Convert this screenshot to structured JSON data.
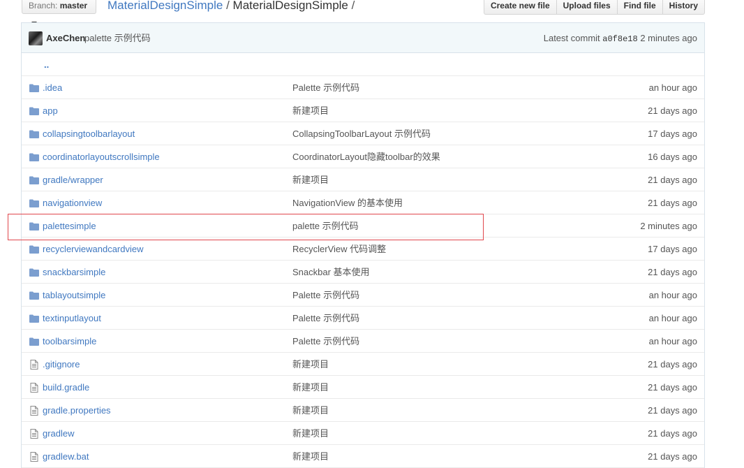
{
  "branch": {
    "prefix": "Branch:",
    "name": "master"
  },
  "breadcrumb": {
    "repo": "MaterialDesignSimple",
    "sep1": "/",
    "folder": "MaterialDesignSimple",
    "sep2": "/"
  },
  "actions": {
    "create_new_file": "Create new file",
    "upload_files": "Upload files",
    "find_file": "Find file",
    "history": "History"
  },
  "commit": {
    "author": "AxeChen",
    "message": "palette 示例代码",
    "latest_label": "Latest commit",
    "sha": "a0f8e18",
    "age": "2 minutes ago"
  },
  "parent_dir": "..",
  "colors": {
    "link": "#4078c0",
    "highlight": "#e0474c",
    "commit_bg": "#f2f8fa"
  },
  "files": [
    {
      "type": "folder",
      "icon": "folder-icon",
      "name": ".idea",
      "message": "Palette 示例代码",
      "age": "an hour ago"
    },
    {
      "type": "folder",
      "icon": "folder-icon",
      "name": "app",
      "message": "新建项目",
      "age": "21 days ago"
    },
    {
      "type": "folder",
      "icon": "folder-icon",
      "name": "collapsingtoolbarlayout",
      "message": "CollapsingToolbarLayout 示例代码",
      "age": "17 days ago"
    },
    {
      "type": "folder",
      "icon": "folder-icon",
      "name": "coordinatorlayoutscrollsimple",
      "message": "CoordinatorLayout隐藏toolbar的效果",
      "age": "16 days ago"
    },
    {
      "type": "folder",
      "icon": "folder-icon",
      "name": "gradle/wrapper",
      "message": "新建项目",
      "age": "21 days ago"
    },
    {
      "type": "folder",
      "icon": "folder-icon",
      "name": "navigationview",
      "message": "NavigationView 的基本使用",
      "age": "21 days ago"
    },
    {
      "type": "folder",
      "icon": "folder-icon",
      "name": "palettesimple",
      "message": "palette 示例代码",
      "age": "2 minutes ago"
    },
    {
      "type": "folder",
      "icon": "folder-icon",
      "name": "recyclerviewandcardview",
      "message": "RecyclerView 代码调整",
      "age": "17 days ago"
    },
    {
      "type": "folder",
      "icon": "folder-icon",
      "name": "snackbarsimple",
      "message": "Snackbar 基本使用",
      "age": "21 days ago"
    },
    {
      "type": "folder",
      "icon": "folder-icon",
      "name": "tablayoutsimple",
      "message": "Palette 示例代码",
      "age": "an hour ago"
    },
    {
      "type": "folder",
      "icon": "folder-icon",
      "name": "textinputlayout",
      "message": "Palette 示例代码",
      "age": "an hour ago"
    },
    {
      "type": "folder",
      "icon": "folder-icon",
      "name": "toolbarsimple",
      "message": "Palette 示例代码",
      "age": "an hour ago"
    },
    {
      "type": "file",
      "icon": "file-icon",
      "name": ".gitignore",
      "message": "新建项目",
      "age": "21 days ago"
    },
    {
      "type": "file",
      "icon": "file-icon",
      "name": "build.gradle",
      "message": "新建项目",
      "age": "21 days ago"
    },
    {
      "type": "file",
      "icon": "file-icon",
      "name": "gradle.properties",
      "message": "新建项目",
      "age": "21 days ago"
    },
    {
      "type": "file",
      "icon": "file-icon",
      "name": "gradlew",
      "message": "新建项目",
      "age": "21 days ago"
    },
    {
      "type": "file",
      "icon": "file-icon",
      "name": "gradlew.bat",
      "message": "新建项目",
      "age": "21 days ago"
    }
  ]
}
